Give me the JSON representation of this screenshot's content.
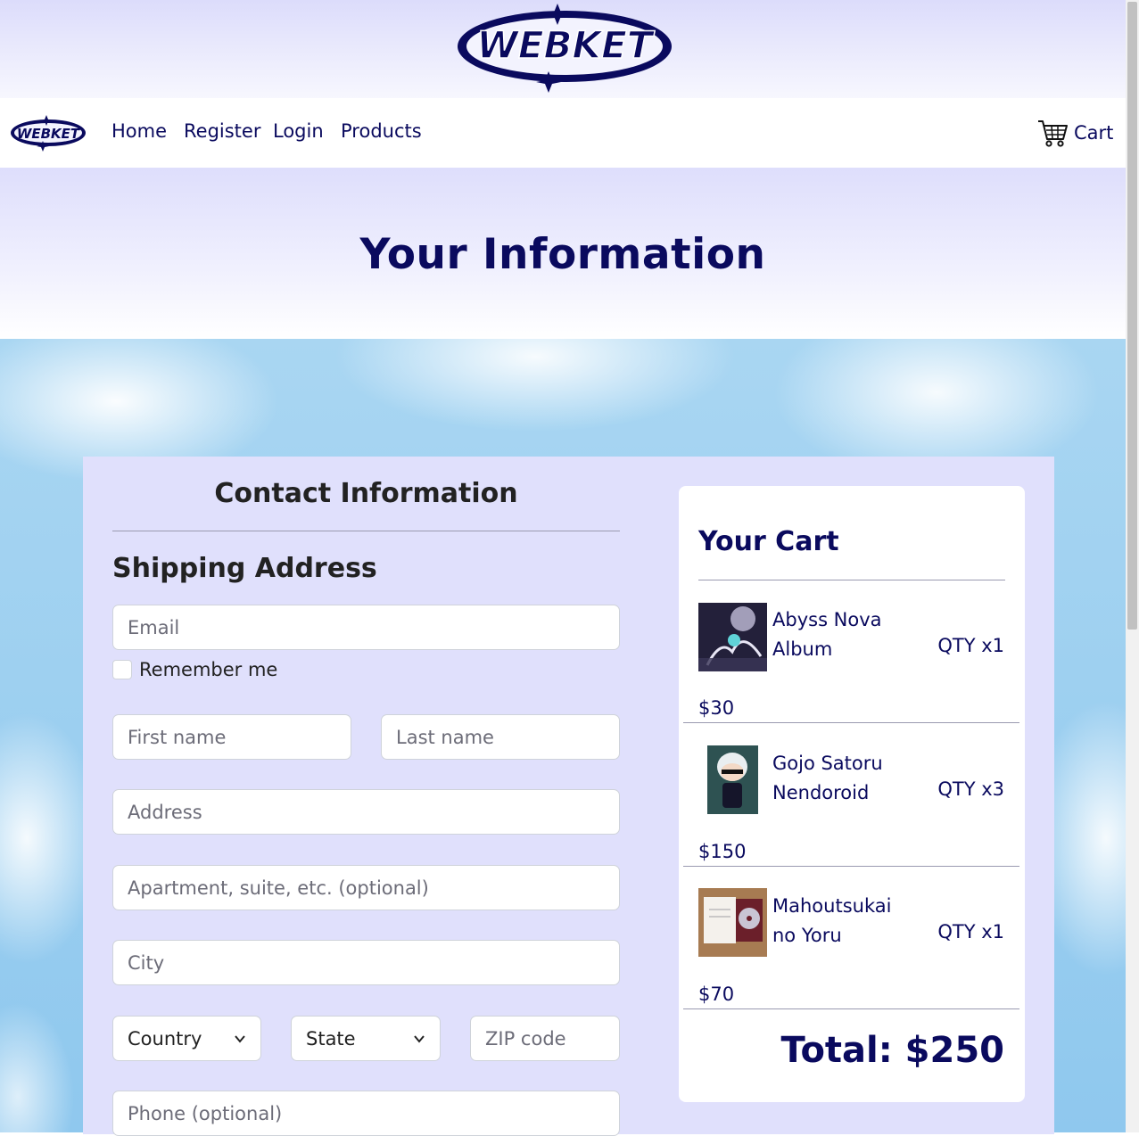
{
  "brand": {
    "name": "WEBKET"
  },
  "nav": {
    "links": [
      "Home",
      "Register",
      "Login",
      "Products"
    ],
    "cart_label": "Cart"
  },
  "hero": {
    "title": "Your Information"
  },
  "contact": {
    "title": "Contact Information"
  },
  "shipping": {
    "title": "Shipping Address",
    "email_placeholder": "Email",
    "remember_label": "Remember me",
    "first_name_placeholder": "First name",
    "last_name_placeholder": "Last name",
    "address_placeholder": "Address",
    "apartment_placeholder": "Apartment, suite, etc. (optional)",
    "city_placeholder": "City",
    "country_selected": "Country",
    "state_selected": "State",
    "zip_placeholder": "ZIP code",
    "phone_placeholder": "Phone (optional)"
  },
  "cart": {
    "title": "Your Cart",
    "items": [
      {
        "name": "Abyss Nova Album",
        "qty": "QTY x1",
        "price": "$30"
      },
      {
        "name": "Gojo Satoru Nendoroid",
        "qty": "QTY x3",
        "price": "$150"
      },
      {
        "name": "Mahoutsukai no Yoru",
        "qty": "QTY x1",
        "price": "$70"
      }
    ],
    "total": "Total: $250"
  },
  "colors": {
    "brand_navy": "#0a0a5e",
    "lavender": "#e0e0fc",
    "sky_blue": "#8fc8ee"
  },
  "icons": [
    "cart-icon",
    "chevron-down-icon"
  ]
}
